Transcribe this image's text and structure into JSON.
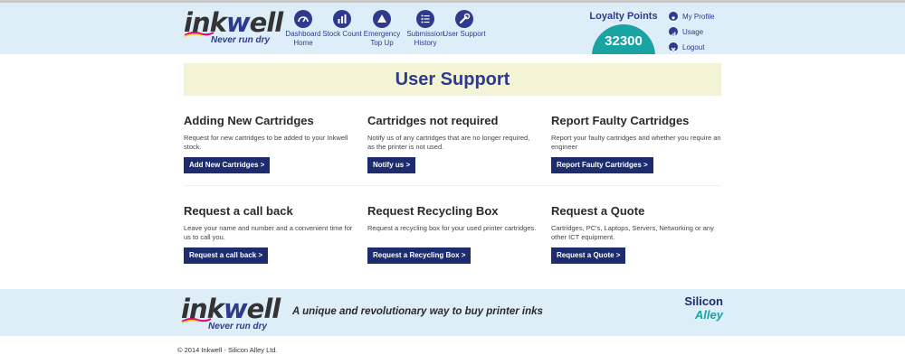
{
  "brand": {
    "logo_word": "inkwell",
    "tagline": "Never run dry"
  },
  "nav": [
    {
      "label": "Dashboard Home",
      "icon": "dashboard-icon"
    },
    {
      "label": "Stock Count",
      "icon": "bar-chart-icon"
    },
    {
      "label": "Emergency Top Up",
      "icon": "up-arrow-icon"
    },
    {
      "label": "Submission History",
      "icon": "list-icon"
    },
    {
      "label": "User Support",
      "icon": "wrench-icon"
    }
  ],
  "loyalty": {
    "title": "Loyalty Points",
    "value": "32300"
  },
  "user_menu": [
    {
      "label": "My Profile",
      "icon": "profile-icon"
    },
    {
      "label": "Usage",
      "icon": "usage-icon"
    },
    {
      "label": "Logout",
      "icon": "logout-icon"
    }
  ],
  "page_title": "User Support",
  "cards": [
    {
      "title": "Adding New Cartridges",
      "desc": "Request for new cartridges to be added to your Inkwell stock.",
      "button": "Add New Cartridges >"
    },
    {
      "title": "Cartridges not required",
      "desc": "Notify us of any cartridges that are no longer required, as the printer is not used.",
      "button": "Notify us >"
    },
    {
      "title": "Report Faulty Cartridges",
      "desc": "Report your faulty cartridges and whether you require an engineer",
      "button": "Report Faulty Cartridges >"
    },
    {
      "title": "Request a call back",
      "desc": "Leave your name and number and a convenient time for us to call you.",
      "button": "Request a call back >"
    },
    {
      "title": "Request Recycling Box",
      "desc": "Request a recycling box for your used printer cartridges.",
      "button": "Request a Recycling Box >"
    },
    {
      "title": "Request a Quote",
      "desc": "Cartridges, PC's, Laptops, Servers, Networking or any other ICT equipment.",
      "button": "Request a Quote >"
    }
  ],
  "footer": {
    "tagline": "A unique and revolutionary way to buy printer inks",
    "partner_line1": "Silicon",
    "partner_line2": "Alley",
    "copyright": "© 2014 Inkwell - Silicon Alley Ltd."
  },
  "colors": {
    "brand_navy": "#2f3a8c",
    "button_navy": "#1c2c6e",
    "teal": "#1aa3a3",
    "header_bg": "#ddeef9",
    "banner_bg": "#f3f4d6"
  }
}
